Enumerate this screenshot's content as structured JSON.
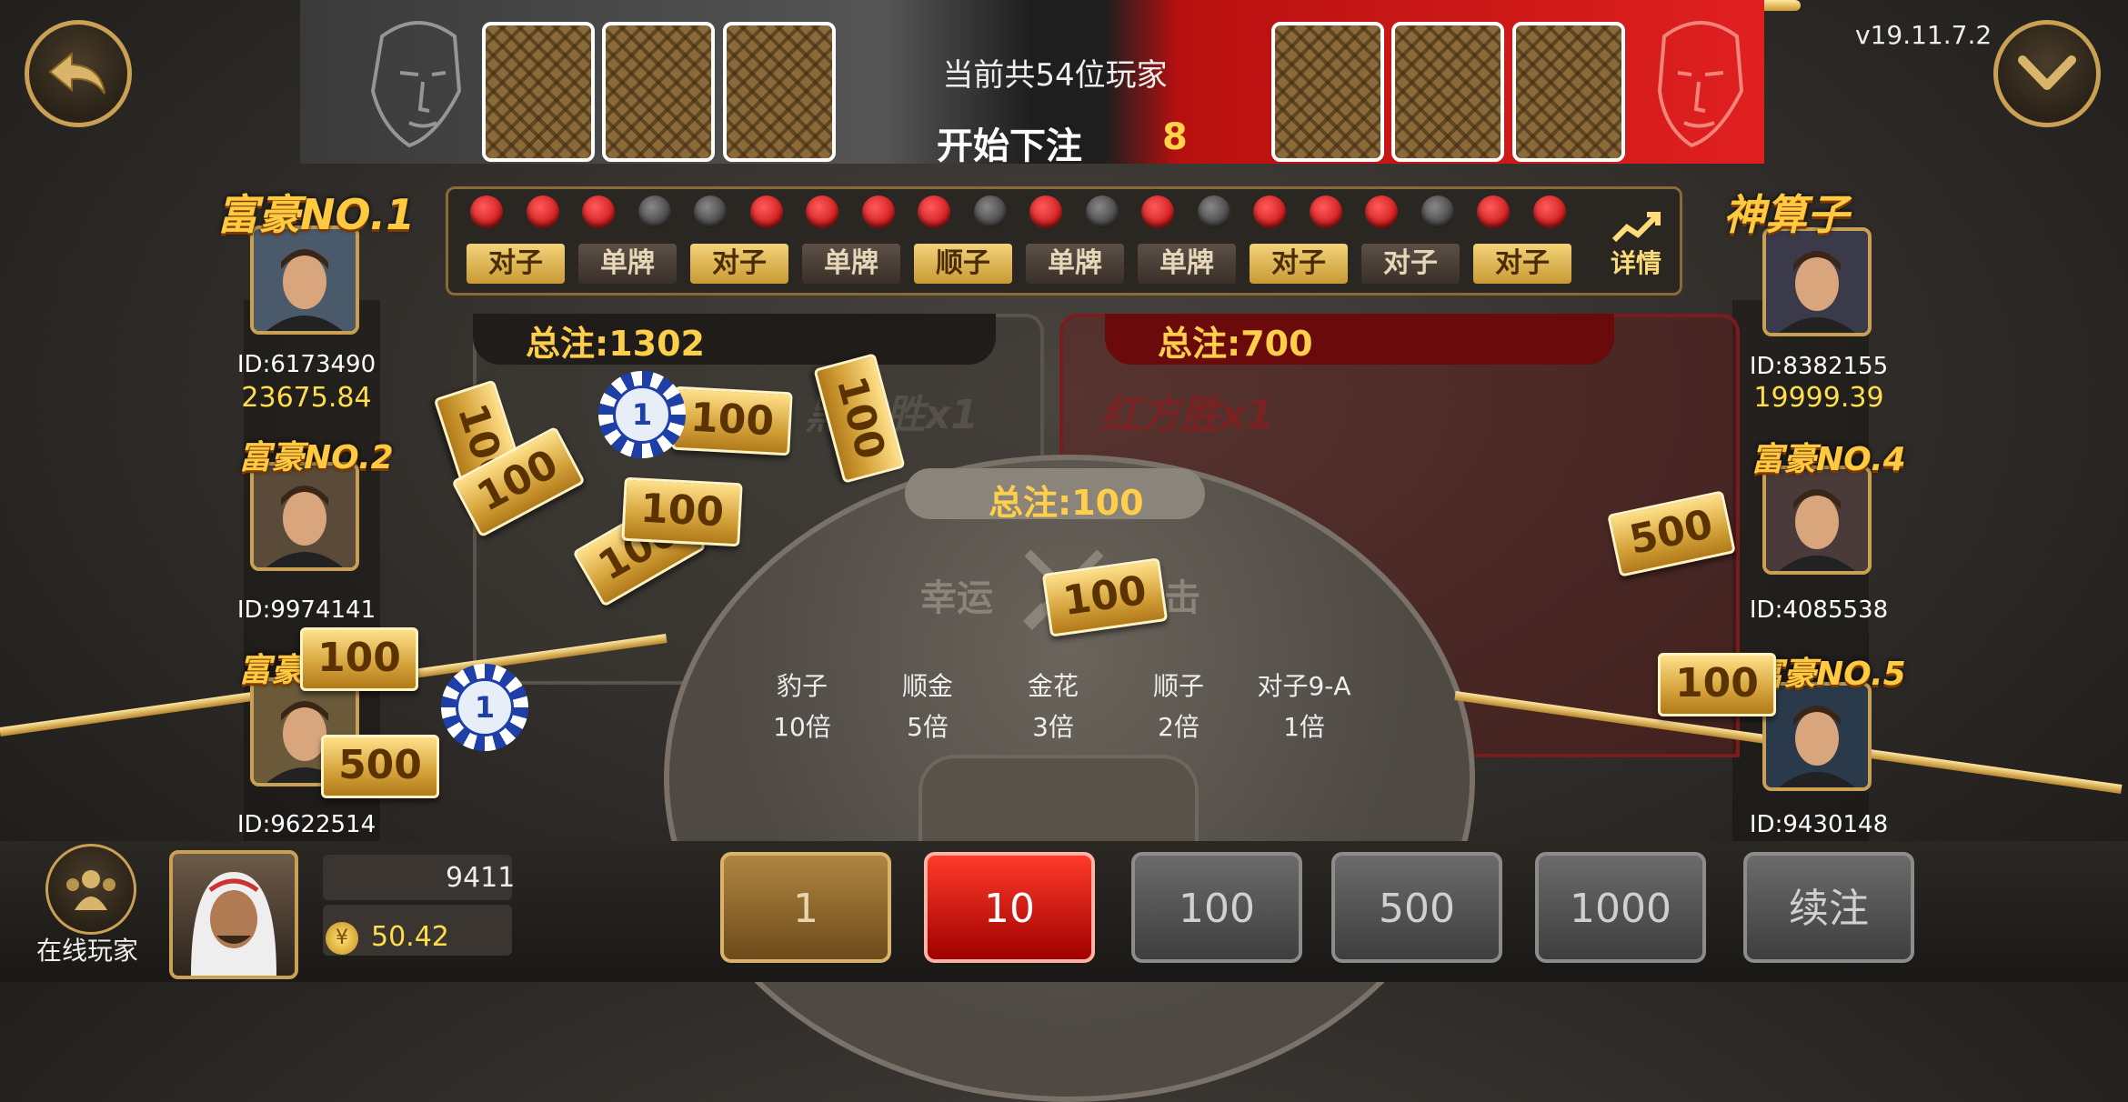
{
  "header": {
    "players_count_text": "当前共54位玩家",
    "status_text": "开始下注",
    "countdown": "8",
    "version": "v19.11.7.2"
  },
  "history": {
    "dots": [
      "red",
      "red",
      "red",
      "black",
      "black",
      "red",
      "red",
      "red",
      "red",
      "black",
      "red",
      "black",
      "red",
      "black",
      "red",
      "red",
      "red",
      "black",
      "red",
      "red"
    ],
    "hands": [
      "对子",
      "单牌",
      "对子",
      "单牌",
      "顺子",
      "单牌",
      "单牌",
      "对子",
      "对子",
      "对子"
    ],
    "hand_styles": [
      "gold",
      "dark",
      "gold",
      "dark",
      "gold",
      "dark",
      "dark",
      "gold",
      "dark",
      "gold"
    ],
    "detail_label": "详情"
  },
  "table": {
    "black_total": "总注:1302",
    "black_label": "黑方胜x1",
    "red_total": "总注:700",
    "red_label": "红方胜x1",
    "lucky_total": "总注:100",
    "lucky_label_left": "幸运",
    "lucky_label_right": "击",
    "odds": [
      {
        "name": "豹子",
        "mult": "10倍"
      },
      {
        "name": "顺金",
        "mult": "5倍"
      },
      {
        "name": "金花",
        "mult": "3倍"
      },
      {
        "name": "顺子",
        "mult": "2倍"
      },
      {
        "name": "对子9-A",
        "mult": "1倍"
      }
    ]
  },
  "players_left": [
    {
      "title": "富豪NO.1",
      "id": "ID:6173490",
      "score": "23675.84"
    },
    {
      "title": "富豪NO.2",
      "id": "ID:9974141",
      "score": ""
    },
    {
      "title": "富豪NO.3",
      "id": "ID:9622514",
      "score": ""
    }
  ],
  "players_right": [
    {
      "title": "神算子",
      "id": "ID:8382155",
      "score": "19999.39"
    },
    {
      "title": "富豪NO.4",
      "id": "ID:4085538",
      "score": ""
    },
    {
      "title": "富豪NO.5",
      "id": "ID:9430148",
      "score": ""
    }
  ],
  "bills": [
    "100",
    "100",
    "100",
    "100",
    "100",
    "100",
    "100",
    "500",
    "100",
    "500",
    "100",
    "100"
  ],
  "chips": [
    "1",
    "1"
  ],
  "bottom": {
    "online_label": "在线玩家",
    "self_id_partial": "9411",
    "balance": "50.42",
    "coin_symbol": "¥",
    "bet_options": [
      "1",
      "10",
      "100",
      "500",
      "1000",
      "续注"
    ],
    "selected_bet": "10"
  },
  "colors": {
    "accent_gold": "#ffce4a",
    "red": "#e02020",
    "score": "#ffde4a"
  }
}
